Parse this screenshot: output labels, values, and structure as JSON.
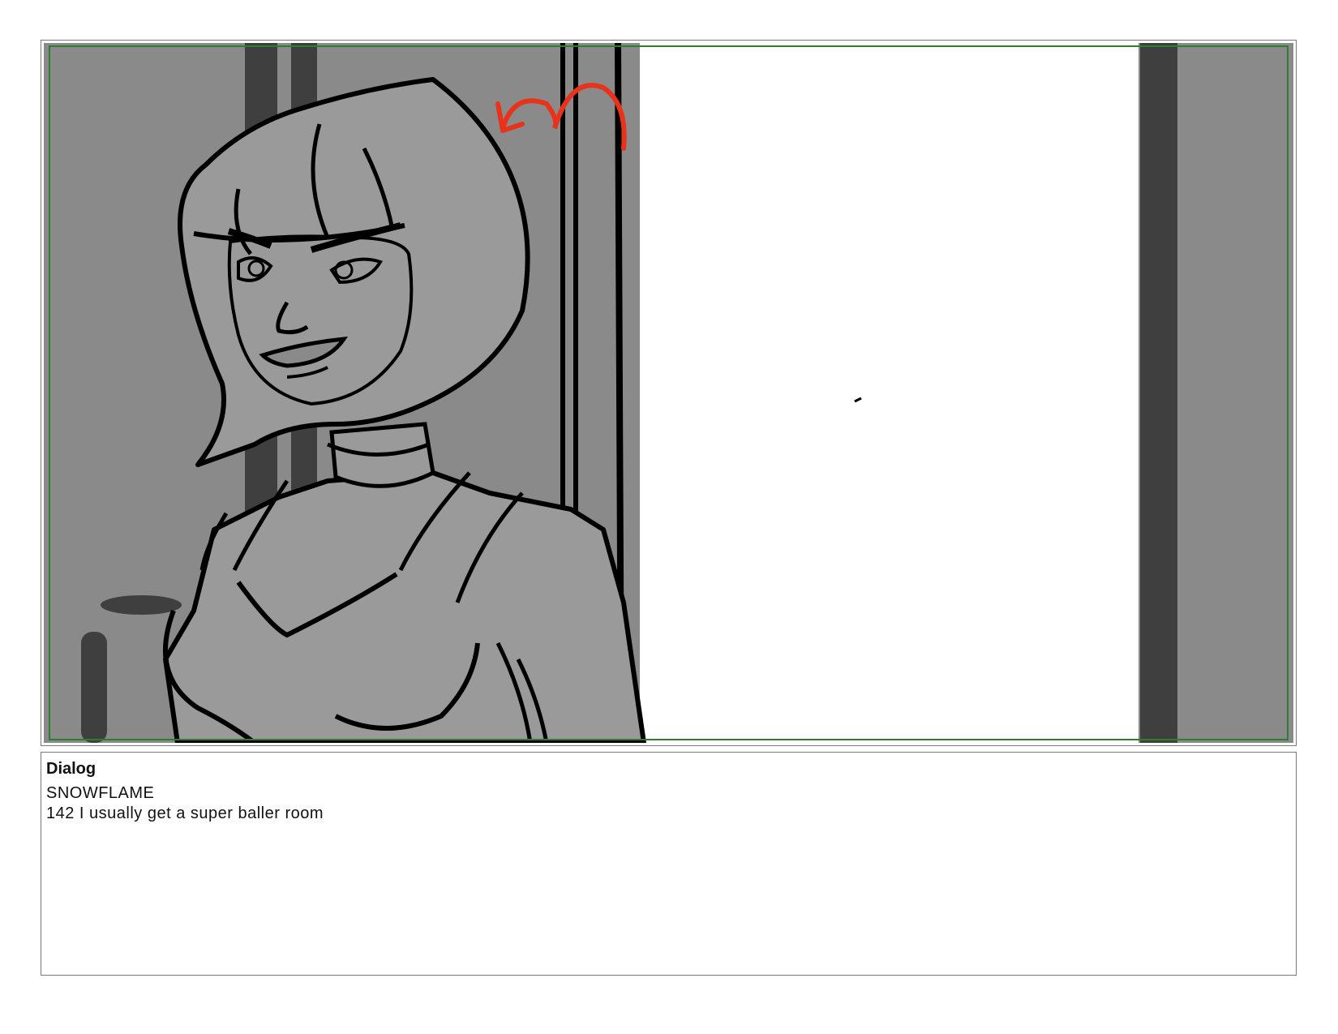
{
  "panel": {
    "image_name": "storyboard-panel-sketch",
    "description_icon": "character-sketch",
    "colors": {
      "background": "#8a8a8a",
      "curtain_dark": "#3f3f3f",
      "figure_fill": "#9a9a9a",
      "line": "#000000",
      "window": "#ffffff",
      "safe_area_border": "#2e7d32",
      "motion_arrow": "#e8321a"
    }
  },
  "dialog": {
    "heading": "Dialog",
    "character": "SNOWFLAME",
    "line": "142 I usually get a super baller room"
  }
}
